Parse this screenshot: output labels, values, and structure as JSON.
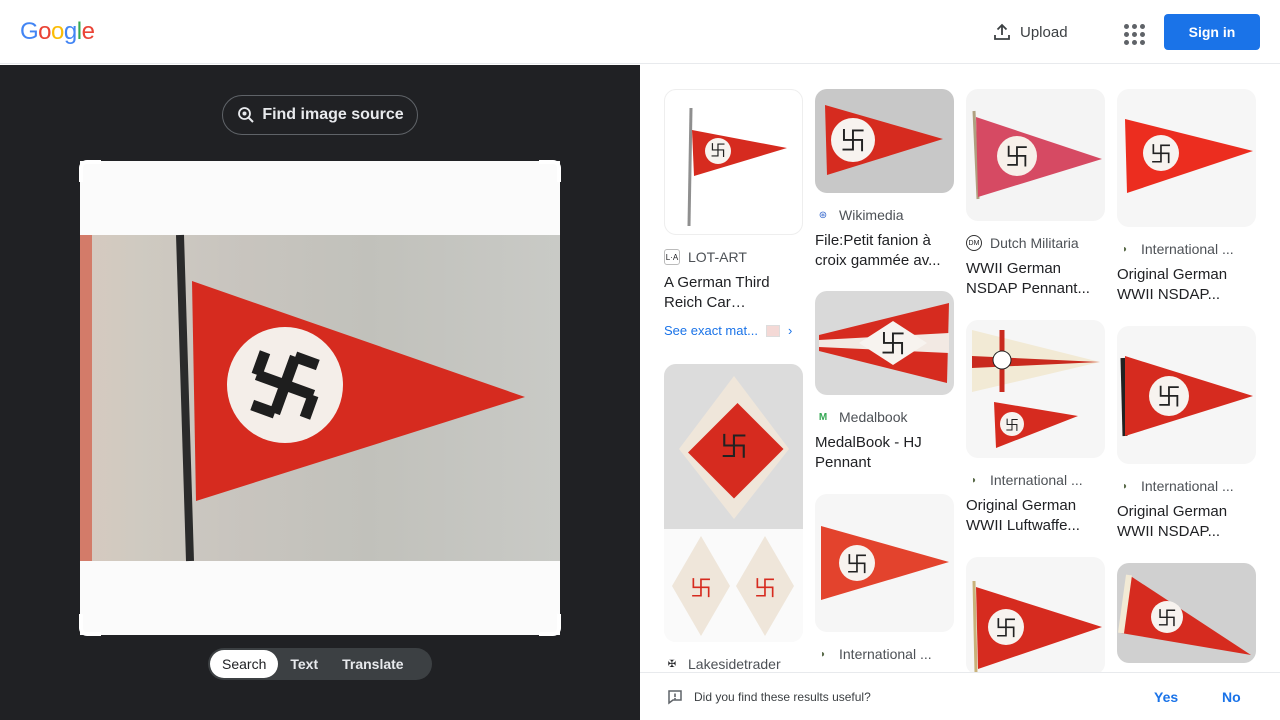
{
  "header": {
    "logo_letters": [
      "G",
      "o",
      "o",
      "g",
      "l",
      "e"
    ],
    "logo_colors": [
      "#4285F4",
      "#EA4335",
      "#FBBC05",
      "#4285F4",
      "#34A853",
      "#EA4335"
    ],
    "upload_label": "Upload",
    "signin_label": "Sign in"
  },
  "left_panel": {
    "find_source_label": "Find image source",
    "modes": [
      "Search",
      "Text",
      "Translate"
    ],
    "active_mode": "Search"
  },
  "results": [
    {
      "source": "LOT-ART",
      "favicon": "L·A",
      "title": "A German Third Reich Car Pennant...",
      "exact_label": "See exact mat..."
    },
    {
      "source": "Wikimedia",
      "favicon": "wikimedia-icon",
      "title": "File:Petit fanion à croix gammée av..."
    },
    {
      "source": "Medalbook",
      "favicon": "medalbook-icon",
      "title": "MedalBook - HJ Pennant"
    },
    {
      "source": "International ...",
      "favicon": "helmet-icon",
      "title": ""
    },
    {
      "source": "Dutch Militaria",
      "favicon": "DM",
      "title": "WWII German NSDAP Pennant..."
    },
    {
      "source": "International ...",
      "favicon": "helmet-icon",
      "title": "Original German WWII Luftwaffe..."
    },
    {
      "source": "International ...",
      "favicon": "helmet-icon",
      "title": "Original German WWII NSDAP..."
    },
    {
      "source": "International ...",
      "favicon": "helmet-icon",
      "title": "Original German WWII NSDAP..."
    },
    {
      "source": "Lakesidetrader",
      "favicon": "cross-icon",
      "title": ""
    }
  ],
  "feedback": {
    "question": "Did you find these results useful?",
    "yes_label": "Yes",
    "no_label": "No"
  },
  "colors": {
    "accent": "#1a73e8",
    "dark_panel": "#202124",
    "flag_red": "#d62b1f"
  }
}
